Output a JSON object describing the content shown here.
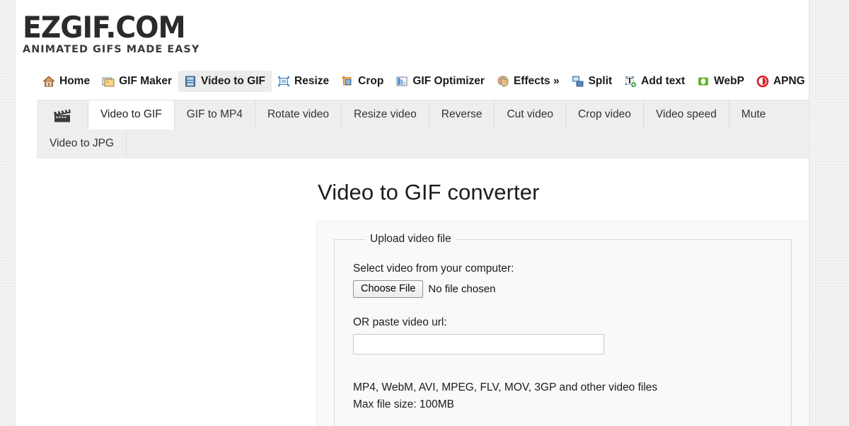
{
  "site": {
    "logo_main": "EZGIF.COM",
    "logo_tagline": "ANIMATED GIFS MADE EASY"
  },
  "mainnav": {
    "items": [
      {
        "label": "Home",
        "icon": "home-icon",
        "active": false
      },
      {
        "label": "GIF Maker",
        "icon": "gif-maker-icon",
        "active": false
      },
      {
        "label": "Video to GIF",
        "icon": "video-to-gif-icon",
        "active": true
      },
      {
        "label": "Resize",
        "icon": "resize-icon",
        "active": false
      },
      {
        "label": "Crop",
        "icon": "crop-icon",
        "active": false
      },
      {
        "label": "GIF Optimizer",
        "icon": "optimizer-icon",
        "active": false
      },
      {
        "label": "Effects »",
        "icon": "effects-palette-icon",
        "active": false
      },
      {
        "label": "Split",
        "icon": "split-icon",
        "active": false
      },
      {
        "label": "Add text",
        "icon": "add-text-icon",
        "active": false
      },
      {
        "label": "WebP",
        "icon": "webp-icon",
        "active": false
      },
      {
        "label": "APNG",
        "icon": "apng-icon",
        "active": false
      }
    ]
  },
  "subnav": {
    "icon": "film-clapper-icon",
    "row1": [
      {
        "label": "Video to GIF",
        "active": true
      },
      {
        "label": "GIF to MP4",
        "active": false
      },
      {
        "label": "Rotate video",
        "active": false
      },
      {
        "label": "Resize video",
        "active": false
      },
      {
        "label": "Reverse",
        "active": false
      },
      {
        "label": "Cut video",
        "active": false
      },
      {
        "label": "Crop video",
        "active": false
      },
      {
        "label": "Video speed",
        "active": false
      },
      {
        "label": "Mute",
        "active": false
      }
    ],
    "row2": [
      {
        "label": "Video to JPG",
        "active": false
      }
    ]
  },
  "main": {
    "title": "Video to GIF converter",
    "fieldset_legend": "Upload video file",
    "file_label": "Select video from your computer:",
    "choose_file_button": "Choose File",
    "no_file_text": "No file chosen",
    "url_label": "OR paste video url:",
    "url_value": "",
    "url_placeholder": "",
    "formats_line": "MP4, WebM, AVI, MPEG, FLV, MOV, 3GP and other video files",
    "maxsize_line": "Max file size: 100MB"
  },
  "colors": {
    "page_bg": "#f4f4f4",
    "content_bg": "#ffffff",
    "subnav_bg": "#eeeeee",
    "active_tab_bg": "#ffffff",
    "panel_bg": "#f8f9fa",
    "text": "#1c1c1c",
    "webp_green": "#63b224",
    "apng_red": "#e01b22",
    "blue_icon": "#3f7fbf",
    "home_roof": "#c07a3a"
  }
}
